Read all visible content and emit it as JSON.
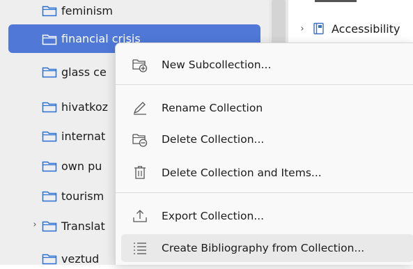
{
  "sidebar": {
    "items": [
      {
        "label": "feminism"
      },
      {
        "label": "financial crisis"
      },
      {
        "label": "glass ce"
      },
      {
        "label": "hivatkoz"
      },
      {
        "label": "internat"
      },
      {
        "label": "own pu"
      },
      {
        "label": "tourism"
      },
      {
        "label": "Translat"
      },
      {
        "label": "veztud"
      }
    ]
  },
  "right_pane": {
    "row_label": "Accessibility"
  },
  "context_menu": {
    "items": [
      {
        "label": "New Subcollection...",
        "icon": "new-subcollection-icon"
      },
      {
        "label": "Rename Collection",
        "icon": "rename-pencil-icon"
      },
      {
        "label": "Delete Collection...",
        "icon": "delete-collection-icon"
      },
      {
        "label": "Delete Collection and Items...",
        "icon": "trash-icon"
      },
      {
        "label": "Export Collection...",
        "icon": "export-icon"
      },
      {
        "label": "Create Bibliography from Collection...",
        "icon": "bibliography-list-icon"
      }
    ]
  },
  "colors": {
    "selection": "#4f78d7",
    "sidebar_bg": "#eeeeee",
    "menu_bg": "#f9f9f9",
    "menu_hover": "#e9e9e9"
  }
}
